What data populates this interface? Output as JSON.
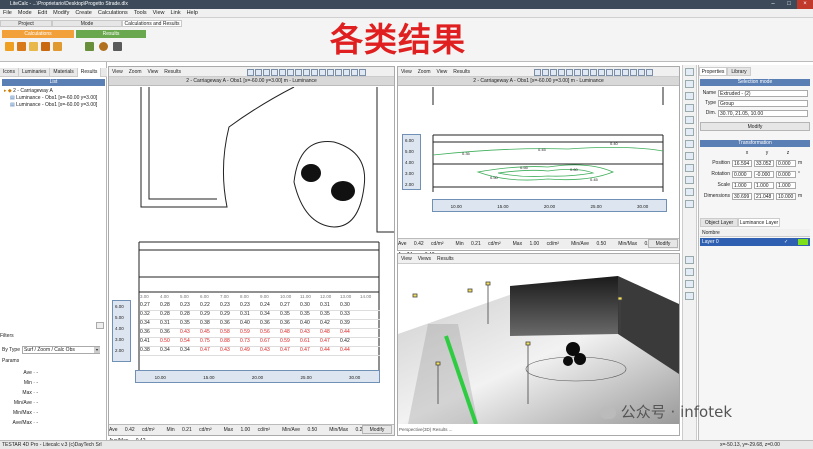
{
  "window": {
    "title": "LiteCalc - ...\\Proprietario\\Desktop\\Progetto Strade.dlx"
  },
  "overlay": {
    "heading": "各类结果",
    "watermark": "公众号 · infotek"
  },
  "menu": [
    "File",
    "Mode",
    "Edit",
    "Modify",
    "Create",
    "Calculations",
    "Tools",
    "View",
    "Link",
    "Help"
  ],
  "ribbon": {
    "tabs": [
      "Project",
      "Mode",
      "Calculations and Results"
    ],
    "groups": [
      "Calculations",
      "Results"
    ]
  },
  "left": {
    "tabs": [
      "Icons",
      "Luminaries",
      "Materials",
      "Results"
    ],
    "list_header": "List",
    "tree": [
      "2 - Carriageway A",
      "Luminance - Obs1 [x=-60.00 y=3.00]",
      "Luminance - Obs1 [x=-60.00 y=3.00]"
    ],
    "filters_label": "Filters",
    "type_label": "By Type",
    "type_value": "Surf / Zoom / Calc Obs",
    "params_label": "Params",
    "stats": [
      {
        "k": "Ave",
        "v": "-"
      },
      {
        "k": "Min",
        "v": "-"
      },
      {
        "k": "Max",
        "v": "-"
      },
      {
        "k": "Min/Ave",
        "v": "-"
      },
      {
        "k": "Min/Max",
        "v": "-"
      },
      {
        "k": "Ave/Max",
        "v": "-"
      }
    ]
  },
  "view_menu": [
    "View",
    "Zoom",
    "View",
    "Results"
  ],
  "view2_menu": [
    "View",
    "Zoom",
    "View",
    "Results"
  ],
  "view3_menu": [
    "View",
    "Views",
    "Results"
  ],
  "left_view": {
    "caption": "2 - Carriageway A - Obs1 [x=-60.00 y=3.00] m - Luminance",
    "status": [
      {
        "k": "Ave",
        "v": "0.42",
        "u": "cd/m²"
      },
      {
        "k": "Min",
        "v": "0.21",
        "u": "cd/m²"
      },
      {
        "k": "Max",
        "v": "1.00",
        "u": "cd/m²"
      },
      {
        "k": "Min/Ave",
        "v": "0.50"
      },
      {
        "k": "Min/Max",
        "v": "0.21"
      },
      {
        "k": "Ave/Max",
        "v": "0.42"
      }
    ],
    "modify": "Modify",
    "grid_header": [
      "3.00",
      "4.00",
      "5.00",
      "6.00",
      "7.00",
      "8.00",
      "9.00",
      "10.00",
      "11.00",
      "12.00",
      "13.00",
      "14.00"
    ],
    "grid_rows": [
      [
        "0.27",
        "0.28",
        "0.23",
        "0.22",
        "0.23",
        "0.23",
        "0.24",
        "0.27",
        "0.30",
        "0.31",
        "0.30"
      ],
      [
        "0.32",
        "0.28",
        "0.28",
        "0.29",
        "0.29",
        "0.31",
        "0.34",
        "0.35",
        "0.35",
        "0.35",
        "0.33"
      ],
      [
        "0.34",
        "0.31",
        "0.35",
        "0.38",
        "0.36",
        "0.40",
        "0.36",
        "0.36",
        "0.40",
        "0.42",
        "0.39"
      ],
      [
        "0.36",
        "0.36",
        "0.43",
        "0.45",
        "0.58",
        "0.59",
        "0.56",
        "0.48",
        "0.43",
        "0.48",
        "0.44"
      ],
      [
        "0.41",
        "0.50",
        "0.54",
        "0.75",
        "0.88",
        "0.73",
        "0.67",
        "0.59",
        "0.61",
        "0.47",
        "0.42"
      ],
      [
        "0.38",
        "0.34",
        "0.34",
        "0.47",
        "0.43",
        "0.49",
        "0.43",
        "0.47",
        "0.47",
        "0.44",
        "0.44"
      ]
    ],
    "red_threshold": 0.42,
    "y_ticks": [
      "6.00",
      "5.00",
      "4.00",
      "3.00",
      "2.00"
    ],
    "x_ticks": [
      "10.00",
      "15.00",
      "20.00",
      "25.00",
      "30.00"
    ]
  },
  "right_view": {
    "caption": "2 - Carriageway A - Obs1 [x=-60.00 y=3.00] m - Luminance",
    "status": [
      {
        "k": "Ave",
        "v": "0.42",
        "u": "cd/m²"
      },
      {
        "k": "Min",
        "v": "0.21",
        "u": "cd/m²"
      },
      {
        "k": "Max",
        "v": "1.00",
        "u": "cd/m²"
      },
      {
        "k": "Min/Ave",
        "v": "0.50"
      },
      {
        "k": "Min/Max",
        "v": "0.21"
      },
      {
        "k": "Ave/Max",
        "v": "0.42"
      }
    ],
    "modify": "Modify",
    "contours": [
      "0.35",
      "0.45",
      "0.40",
      "0.55",
      "0.60",
      "0.50",
      "0.45"
    ],
    "y_ticks": [
      "6.00",
      "5.00",
      "4.00",
      "3.00",
      "2.00"
    ],
    "x_ticks": [
      "10.00",
      "15.00",
      "20.00",
      "25.00",
      "30.00"
    ]
  },
  "view3d_status": "Perspective(3D) Results ...",
  "properties": {
    "tabs": [
      "Properties",
      "Library"
    ],
    "selection_mode": "Selection mode",
    "name_label": "Name",
    "name_value": "Extruded - (2)",
    "type_label": "Type",
    "type_value": "Group",
    "dims_label": "Dim.",
    "dims_value": "30.70, 21.05, 10.00",
    "modify": "Modify",
    "transformation": "Transformation",
    "axes": [
      "x",
      "y",
      "z"
    ],
    "rows": [
      {
        "k": "Position",
        "v": [
          "16.594",
          "33.052",
          "0.000"
        ],
        "u": "m"
      },
      {
        "k": "Rotation",
        "v": [
          "0.000",
          "-0.000",
          "0.000"
        ],
        "u": "°"
      },
      {
        "k": "Scale",
        "v": [
          "1.000",
          "1.000",
          "1.000"
        ],
        "u": ""
      },
      {
        "k": "Dimensions",
        "v": [
          "30.699",
          "21.048",
          "10.000"
        ],
        "u": "m"
      }
    ],
    "layer_tabs": [
      "Object Layer",
      "Luminance Layer"
    ],
    "layer_col": "Nombre",
    "layer_item": "Layer 0"
  },
  "bottom": {
    "left": "TESTAR 4D Pro - Litecalc v.3    (c)DayTech Srl",
    "right": "x=-50.13, y=-29.68, z=0.00"
  },
  "colors": {
    "accent": "#5a7fb5",
    "ribbon_calc": "#f2a13a",
    "ribbon_results": "#6aa84f",
    "red": "#e02020",
    "layer_green": "#7ee01a",
    "lane_green": "#2ecc40"
  }
}
